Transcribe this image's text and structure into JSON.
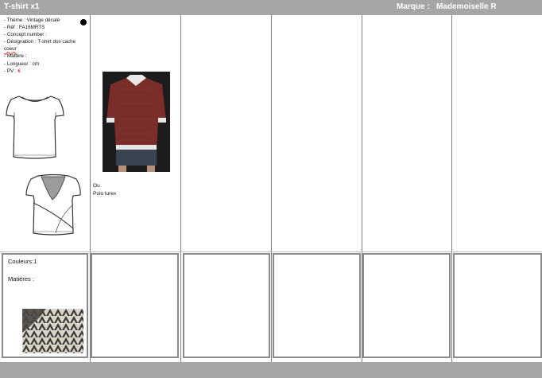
{
  "header": {
    "title": "T-shirt x1",
    "brand_label": "Marque :",
    "brand_value": "Mademoiselle R"
  },
  "product": {
    "theme": "- Thème : Vintage décalé",
    "ref": "- Réf : FA16MRTS",
    "concept": "-  Concept number :",
    "designation_prefix": "- Désignation : T-shirt dos cache",
    "designation_word": "coeur",
    "matiere": "- Matière :",
    "longueur": "- Longueur :  cm",
    "pv_label": "- PV : ",
    "pv_currency": "€"
  },
  "alternative": {
    "line1": "Ou",
    "line2": "Polo lurex"
  },
  "details_box": {
    "colors": "Couleurs:1",
    "materials": "Matières :"
  },
  "colors": {
    "bar": "#a6a6a6",
    "price_accent": "#e3001b"
  },
  "icons": [
    "bullet-dot-icon",
    "tshirt-front-sketch",
    "tshirt-back-sketch",
    "polo-photo",
    "fabric-swatch"
  ]
}
